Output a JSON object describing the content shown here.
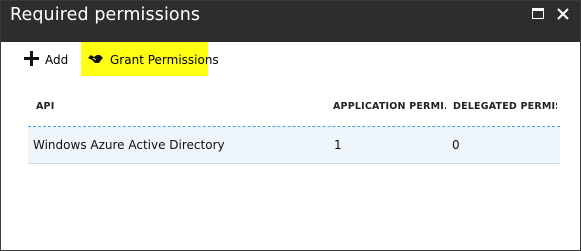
{
  "window": {
    "title": "Required permissions"
  },
  "toolbar": {
    "add_label": "Add",
    "grant_label": "Grant Permissions",
    "highlight_color": "#ffff14"
  },
  "table": {
    "columns": [
      "API",
      "APPLICATION PERMI...",
      "DELEGATED PERMIS..."
    ],
    "rows": [
      {
        "api": "Windows Azure Active Directory",
        "application": "1",
        "delegated": "0"
      }
    ]
  },
  "colors": {
    "titlebar": "#2d2d2d",
    "row_selected": "#eef6fc",
    "header_divider": "#4aa3e0"
  },
  "icons": {
    "maximize": "maximize-icon",
    "close": "close-icon",
    "add": "plus-icon",
    "grant": "grant-permissions-icon"
  }
}
